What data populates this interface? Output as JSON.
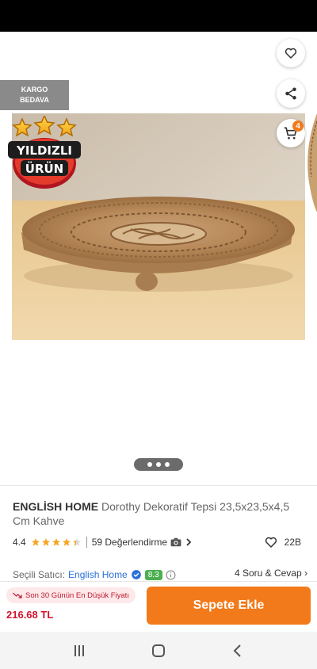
{
  "badges": {
    "kargo_line1": "KARGO",
    "kargo_line2": "BEDAVA",
    "yildizli_line1": "YILDIZLI",
    "yildizli_line2": "ÜRÜN"
  },
  "cart": {
    "count": "4"
  },
  "gallery": {
    "images": 3,
    "active_index": 0
  },
  "product": {
    "brand": "ENGLİSH HOME",
    "name": "Dorothy Dekoratif Tepsi 23,5x23,5x4,5 Cm Kahve",
    "rating": "4.4",
    "rating_value": 4.4,
    "rating_max": 5,
    "reviews": "59 Değerlendirme",
    "favorites": "22B"
  },
  "seller": {
    "label": "Seçili Satıcı:",
    "name": "English Home",
    "score": "8.3",
    "qa": "4 Soru & Cevap"
  },
  "bottom": {
    "lowest_price_note": "Son 30 Günün En Düşük Fiyatı",
    "price": "216.68 TL",
    "add_to_cart": "Sepete Ekle"
  },
  "colors": {
    "accent": "#f27a1a",
    "price": "#d0142c",
    "seller_link": "#2a70d8",
    "score": "#4cb050"
  },
  "icons": [
    "back-arrow-icon",
    "heart-icon",
    "share-icon",
    "cart-icon",
    "star-icon",
    "camera-icon",
    "chevron-right-icon",
    "verified-icon",
    "info-icon",
    "trend-down-icon",
    "recents-icon",
    "home-icon",
    "back-icon"
  ]
}
